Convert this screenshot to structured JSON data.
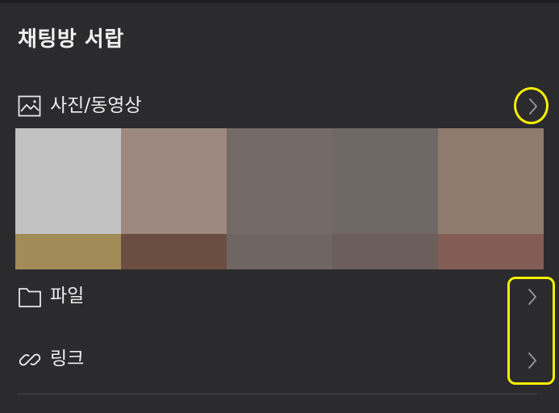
{
  "drawer": {
    "title": "채팅방 서랍"
  },
  "photos": {
    "label": "사진/동영상",
    "icon": "image-icon",
    "thumbnails": [
      {
        "top_color": "#c2c2c2",
        "bottom_color": "#a18c57"
      },
      {
        "top_color": "#9c887e",
        "bottom_color": "#6b4e42"
      },
      {
        "top_color": "#746a66",
        "bottom_color": "#6f6562"
      },
      {
        "top_color": "#706864",
        "bottom_color": "#6a5f5a"
      },
      {
        "top_color": "#917a6e",
        "bottom_color": "#835d55"
      }
    ]
  },
  "files": {
    "label": "파일",
    "icon": "folder-icon"
  },
  "links": {
    "label": "링크",
    "icon": "link-icon"
  },
  "colors": {
    "background": "#2b2b2d",
    "text": "#ececec",
    "chevron": "#9a9a9c",
    "highlight": "#f6f000"
  }
}
